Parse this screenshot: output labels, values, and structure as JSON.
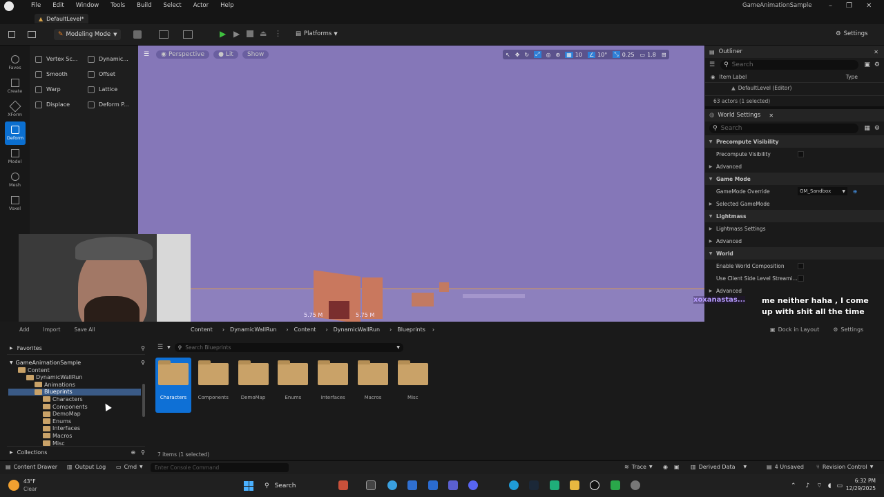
{
  "menu": [
    "File",
    "Edit",
    "Window",
    "Tools",
    "Build",
    "Select",
    "Actor",
    "Help"
  ],
  "window_title": "GameAnimationSample",
  "level_tab": "DefaultLevel*",
  "toolbar": {
    "mode": "Modeling Mode",
    "platforms": "Platforms",
    "settings": "Settings"
  },
  "left_tools": [
    "Faves",
    "Create",
    "XForm",
    "Deform",
    "Model",
    "Mesh",
    "Voxel"
  ],
  "tool_buttons": [
    "Vertex Sc...",
    "Dynamic...",
    "Smooth",
    "Offset",
    "Warp",
    "Lattice",
    "Displace",
    "Deform P..."
  ],
  "viewport": {
    "perspective": "Perspective",
    "lit": "Lit",
    "show": "Show",
    "grid": "10",
    "angle": "10°",
    "scale": "0.25",
    "speed": "1.8",
    "measure_a": "5.75 M",
    "measure_b": "5.75 M"
  },
  "outliner": {
    "title": "Outliner",
    "search_placeholder": "Search",
    "col_label": "Item Label",
    "col_type": "Type",
    "item": "DefaultLevel (Editor)",
    "count": "63 actors (1 selected)"
  },
  "world_settings": {
    "title": "World Settings",
    "search_placeholder": "Search",
    "rows": [
      {
        "label": "Precompute Visibility",
        "kind": "section"
      },
      {
        "label": "Precompute Visibility",
        "kind": "check"
      },
      {
        "label": "Advanced",
        "kind": "sub"
      },
      {
        "label": "Game Mode",
        "kind": "section"
      },
      {
        "label": "GameMode Override",
        "kind": "value",
        "value": "GM_Sandbox"
      },
      {
        "label": "Selected GameMode",
        "kind": "sub"
      },
      {
        "label": "Lightmass",
        "kind": "section"
      },
      {
        "label": "Lightmass Settings",
        "kind": "sub"
      },
      {
        "label": "Advanced",
        "kind": "sub"
      },
      {
        "label": "World",
        "kind": "section"
      },
      {
        "label": "Enable World Composition",
        "kind": "check"
      },
      {
        "label": "Use Client Side Level Streami...",
        "kind": "check"
      }
    ],
    "advanced_bottom": "Advanced"
  },
  "chat": {
    "user": "xoxanastas...",
    "message": "me neither haha , I come up with shit all the time"
  },
  "drawer": {
    "add": "Add",
    "import": "Import",
    "save_all": "Save All",
    "breadcrumb": [
      "Content",
      "DynamicWallRun",
      "Content",
      "DynamicWallRun",
      "Blueprints"
    ],
    "search_placeholder": "Search Blueprints",
    "layout": "Dock in Layout",
    "settings": "Settings",
    "favorites": "Favorites",
    "project": "GameAnimationSample",
    "collections": "Collections",
    "tree": [
      {
        "label": "Content",
        "indent": 0
      },
      {
        "label": "DynamicWallRun",
        "indent": 1
      },
      {
        "label": "Animations",
        "indent": 2
      },
      {
        "label": "Blueprints",
        "indent": 2,
        "selected": true
      },
      {
        "label": "Characters",
        "indent": 3
      },
      {
        "label": "Components",
        "indent": 3
      },
      {
        "label": "DemoMap",
        "indent": 3
      },
      {
        "label": "Enums",
        "indent": 3
      },
      {
        "label": "Interfaces",
        "indent": 3
      },
      {
        "label": "Macros",
        "indent": 3
      },
      {
        "label": "Misc",
        "indent": 3
      }
    ],
    "folders": [
      "Characters",
      "Components",
      "DemoMap",
      "Enums",
      "Interfaces",
      "Macros",
      "Misc"
    ],
    "items_count": "7 items (1 selected)"
  },
  "statusbar": {
    "content_drawer": "Content Drawer",
    "output_log": "Output Log",
    "cmd": "Cmd",
    "console_placeholder": "Enter Console Command",
    "trace": "Trace",
    "derived_data": "Derived Data",
    "unsaved": "4 Unsaved",
    "revision_control": "Revision Control"
  },
  "taskbar": {
    "temp": "43°F",
    "weather": "Clear",
    "search": "Search",
    "time": "6:32 PM",
    "date": "12/29/2025"
  }
}
